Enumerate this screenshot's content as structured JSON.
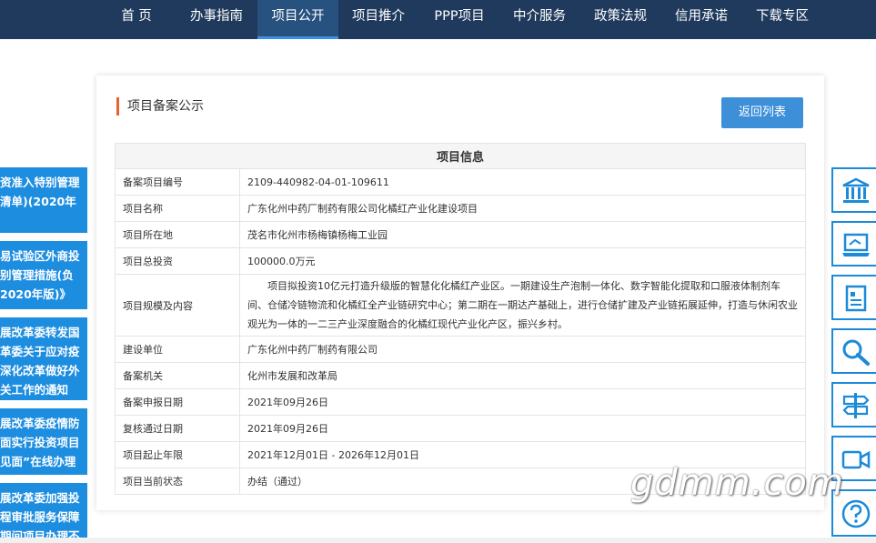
{
  "nav": {
    "items": [
      {
        "label": "首 页",
        "active": false
      },
      {
        "label": "办事指南",
        "active": false
      },
      {
        "label": "项目公开",
        "active": true
      },
      {
        "label": "项目推介",
        "active": false
      },
      {
        "label": "PPP项目",
        "active": false
      },
      {
        "label": "中介服务",
        "active": false
      },
      {
        "label": "政策法规",
        "active": false
      },
      {
        "label": "信用承诺",
        "active": false
      },
      {
        "label": "下载专区",
        "active": false
      }
    ]
  },
  "news": [
    "资准入特别管理清单)(2020年",
    "易试验区外商投别管理措施(负2020年版)》",
    "展改革委转发国革委关于应对疫深化改革做好外关工作的通知",
    "展改革委疫情防面实行投资项目见面”在线办理",
    "展改革委加强投程审批服务保障期间项目办理不"
  ],
  "panel": {
    "title": "项目备案公示",
    "back_label": "返回列表",
    "table_header": "项目信息",
    "rows": [
      {
        "label": "备案项目编号",
        "value": "2109-440982-04-01-109611"
      },
      {
        "label": "项目名称",
        "value": "广东化州中药厂制药有限公司化橘红产业化建设项目"
      },
      {
        "label": "项目所在地",
        "value": "茂名市化州市杨梅镇杨梅工业园"
      },
      {
        "label": "项目总投资",
        "value": "100000.0万元"
      },
      {
        "label": "项目规模及内容",
        "value": "项目拟投资10亿元打造升级版的智慧化化橘红产业区。一期建设生产泡制一体化、数字智能化提取和口服液体制剂车间、仓储冷链物流和化橘红全产业链研究中心；第二期在一期达产基础上，进行仓储扩建及产业链拓展延伸，打造与休闲农业观光为一体的一二三产业深度融合的化橘红现代产业化产区，振兴乡村。"
      },
      {
        "label": "建设单位",
        "value": "广东化州中药厂制药有限公司"
      },
      {
        "label": "备案机关",
        "value": "化州市发展和改革局"
      },
      {
        "label": "备案申报日期",
        "value": "2021年09月26日"
      },
      {
        "label": "复核通过日期",
        "value": "2021年09月26日"
      },
      {
        "label": "项目起止年限",
        "value": "2021年12月01日 - 2026年12月01日"
      },
      {
        "label": "项目当前状态",
        "value": "办结（通过）"
      }
    ]
  },
  "tools": [
    "bank-icon",
    "computer-icon",
    "document-icon",
    "search-icon",
    "signpost-icon",
    "video-icon",
    "help-icon"
  ],
  "watermark": "gdmm.com",
  "colors": {
    "nav_bg": "#1f3a5c",
    "accent_blue": "#1d8de0",
    "title_bar": "#e8622c",
    "button": "#3d8fd8"
  }
}
